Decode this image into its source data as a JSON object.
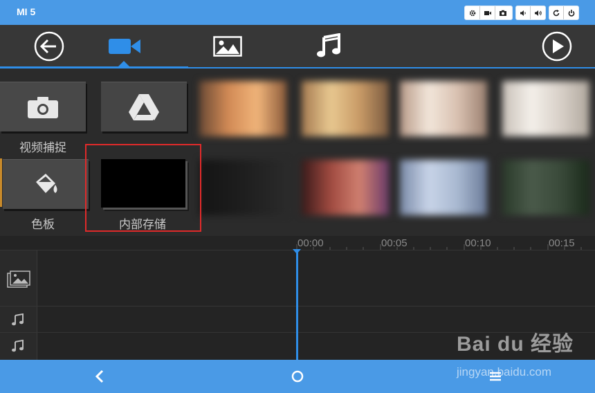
{
  "status_bar": {
    "device_name": "MI 5",
    "controls": [
      "settings-icon",
      "video-record-icon",
      "camera-icon",
      "volume-down-icon",
      "volume-up-icon",
      "rotate-icon",
      "power-icon"
    ]
  },
  "toolbar": {
    "back": "back-arrow-icon",
    "tabs": [
      "video-tab",
      "image-tab",
      "music-tab"
    ],
    "selected_tab": "video-tab",
    "play": "play-icon"
  },
  "sources": [
    {
      "label": "视频捕捉",
      "icon": "camera-icon"
    },
    {
      "label": "",
      "icon": "google-drive-icon"
    },
    {
      "label": "色板",
      "icon": "paint-bucket-icon"
    },
    {
      "label": "内部存储",
      "icon": "folder-thumbnail"
    }
  ],
  "timeline": {
    "ruler": [
      "00:00",
      "00:05",
      "00:10",
      "00:15"
    ],
    "tracks": [
      "video-image-track-icon",
      "music-note-icon",
      "music-note-icon"
    ]
  },
  "nav_bar": [
    "back-nav-icon",
    "home-nav-icon",
    "menu-nav-icon"
  ],
  "watermark": {
    "logo": "Bai du 经验",
    "url": "jingyan.baidu.com"
  },
  "colors": {
    "accent": "#2f8ee8",
    "status_bar": "#4a9ae6",
    "highlight_box": "#e02a2a"
  }
}
